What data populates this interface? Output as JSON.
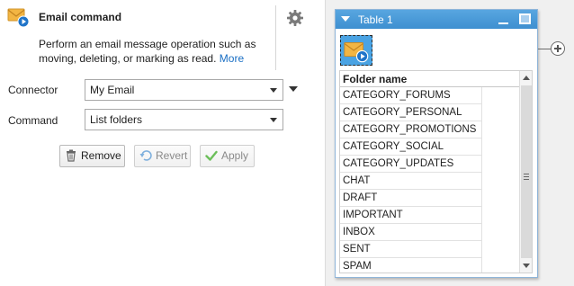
{
  "panel": {
    "title": "Email command",
    "description": "Perform an email message operation such as moving, deleting, or marking as read.",
    "more_link": "More",
    "connector": {
      "label": "Connector",
      "value": "My Email"
    },
    "command": {
      "label": "Command",
      "value": "List folders"
    },
    "buttons": {
      "remove": "Remove",
      "revert": "Revert",
      "apply": "Apply"
    }
  },
  "canvas": {
    "table": {
      "title": "Table 1",
      "column_header": "Folder name",
      "rows": [
        "CATEGORY_FORUMS",
        "CATEGORY_PERSONAL",
        "CATEGORY_PROMOTIONS",
        "CATEGORY_SOCIAL",
        "CATEGORY_UPDATES",
        "CHAT",
        "DRAFT",
        "IMPORTANT",
        "INBOX",
        "SENT",
        "SPAM"
      ]
    }
  },
  "icons": {
    "header": "email-command-icon",
    "settings": "gear-icon",
    "remove": "trash-icon",
    "revert": "undo-icon",
    "apply": "checkmark-icon",
    "node": "email-node-icon",
    "add": "plus-circle-icon"
  },
  "colors": {
    "accent": "#4aa3e3",
    "titlebar": "#3e8fd0",
    "link": "#1a6fc4",
    "apply_check": "#6cbf5a"
  }
}
